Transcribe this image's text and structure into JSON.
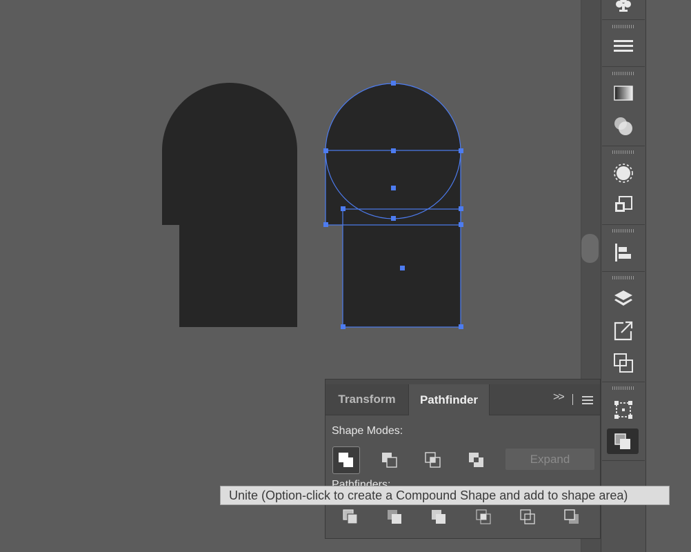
{
  "colors": {
    "canvas": "#5c5c5c",
    "shape_fill": "#262626",
    "selection": "#4d7cf0",
    "panel": "#535353",
    "tooltip_bg": "#dcdcdc"
  },
  "canvas": {
    "shapes": [
      "merged-arch-shape",
      "circle-shape",
      "rectangle-shape-top",
      "rectangle-shape-bottom"
    ]
  },
  "dock": {
    "icons": [
      "club-icon",
      "stroke-lines-icon",
      "gradient-icon",
      "transparency-icon",
      "appearance-icon",
      "graphic-styles-icon",
      "align-icon",
      "layers-icon",
      "export-icon",
      "artboards-icon",
      "transform-icon",
      "pathfinder-icon"
    ]
  },
  "panel": {
    "tabs": [
      {
        "label": "Transform",
        "active": false
      },
      {
        "label": "Pathfinder",
        "active": true
      }
    ],
    "collapse_label": ">>",
    "shape_modes_label": "Shape Modes:",
    "shape_mode_buttons": [
      "unite-icon",
      "minus-front-icon",
      "intersect-icon",
      "exclude-icon"
    ],
    "expand_label": "Expand",
    "pathfinders_label": "Pathfinders:",
    "pathfinder_buttons": [
      "divide-icon",
      "trim-icon",
      "merge-icon",
      "crop-icon",
      "outline-icon",
      "minus-back-icon"
    ]
  },
  "tooltip": {
    "text": "Unite (Option-click to create a Compound Shape and add to shape area)"
  }
}
